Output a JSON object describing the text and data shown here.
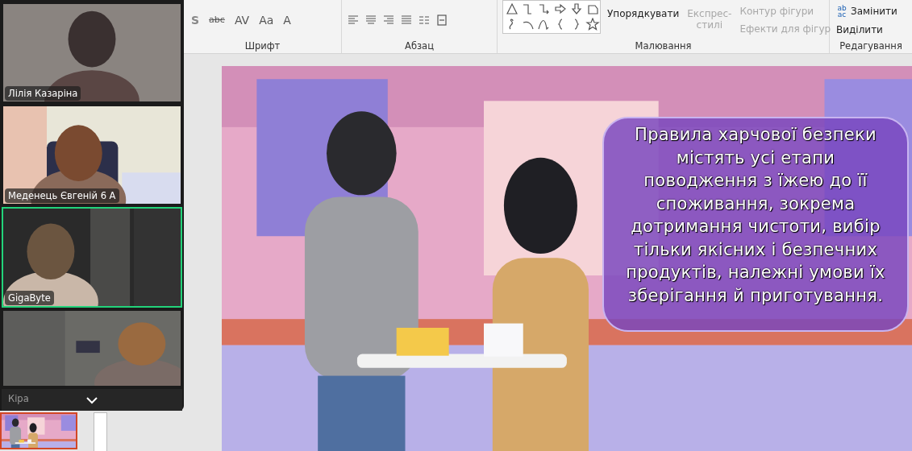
{
  "participants": [
    {
      "name": "Лілія Казаріна",
      "speaking": false
    },
    {
      "name": "Меденець Євгеній 6 А",
      "speaking": false
    },
    {
      "name": "GigaByte",
      "speaking": true
    },
    {
      "name": "Кіра",
      "speaking": false
    }
  ],
  "ribbon": {
    "font_tools": [
      "S",
      "abc",
      "AV",
      "Aa",
      "A"
    ],
    "groups": [
      {
        "label": "Шрифт"
      },
      {
        "label": "Абзац"
      },
      {
        "label": "Малювання"
      },
      {
        "label": "Редагування"
      }
    ],
    "arrange": {
      "label": "Упорядкувати",
      "disabled": false
    },
    "quick_styles": {
      "label": "Експрес-стилі",
      "disabled": true
    },
    "shape_commands": [
      {
        "label": "Контур фігури",
        "disabled": true
      },
      {
        "label": "Ефекти для фігур",
        "disabled": true
      }
    ],
    "editing_commands": [
      {
        "label": "Замінити",
        "icon_text": "ab ac",
        "disabled": false
      },
      {
        "label": "Виділити",
        "disabled": false
      }
    ]
  },
  "slide": {
    "text_box": "Правила харчової безпеки містять усі етапи поводження з їжею до її споживання, зокрема дотримання чистоти, вибір тільки якісних і безпечних продуктів, належні умови їх зберігання й приготування."
  },
  "thumbnails": [
    {
      "selected": true
    }
  ]
}
